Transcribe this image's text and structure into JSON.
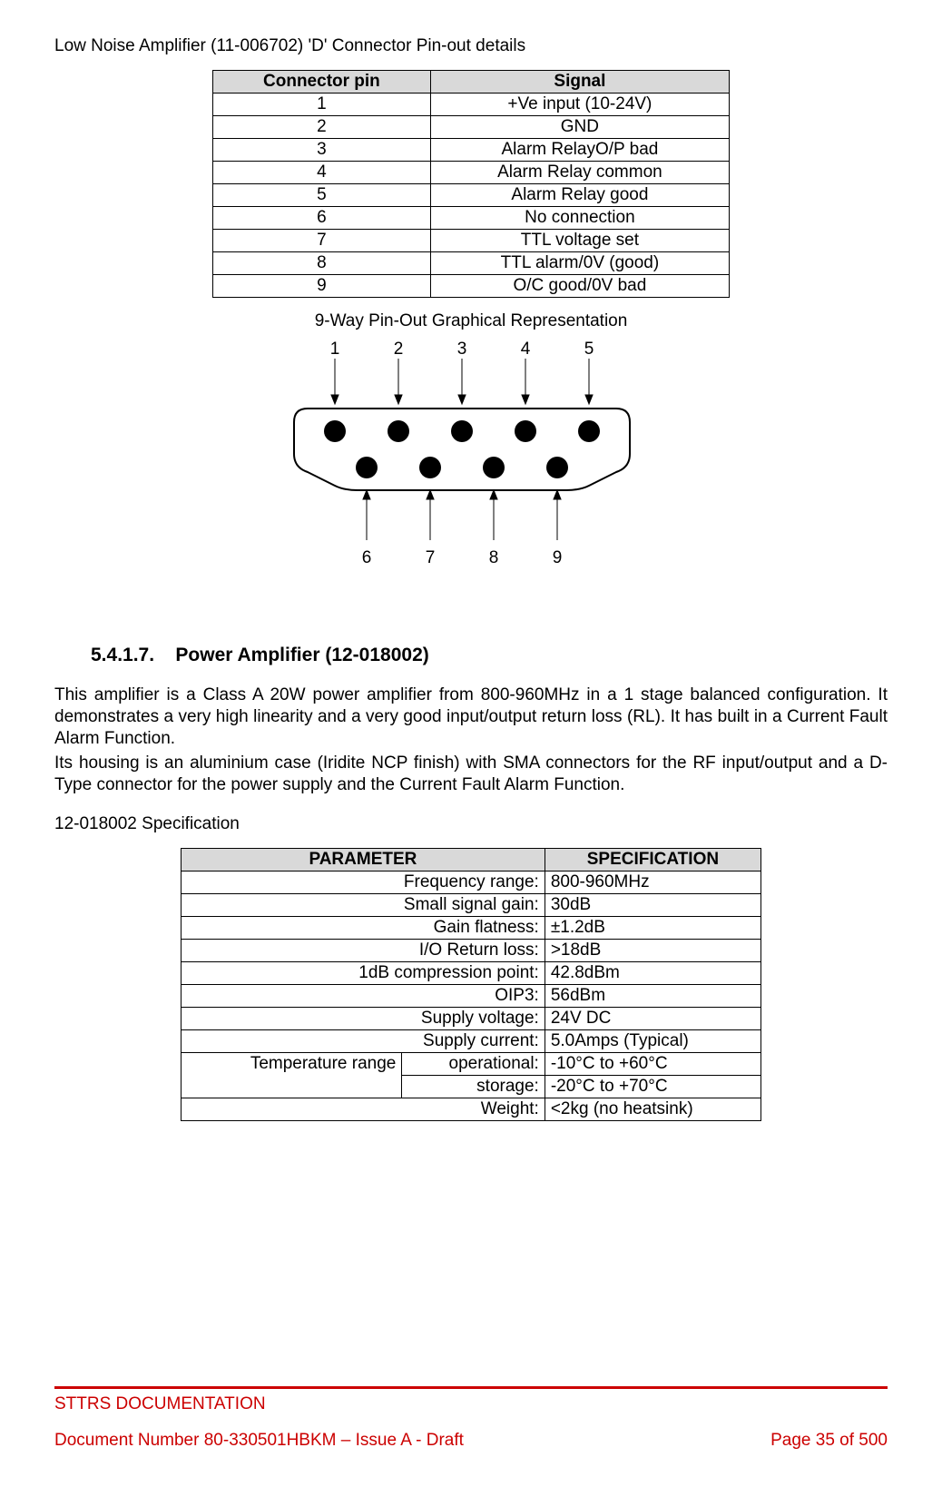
{
  "page_title": "Low Noise Amplifier (11-006702) 'D' Connector Pin-out details",
  "pinout_table": {
    "headers": [
      "Connector pin",
      "Signal"
    ],
    "rows": [
      {
        "pin": "1",
        "signal": "+Ve input (10-24V)"
      },
      {
        "pin": "2",
        "signal": "GND"
      },
      {
        "pin": "3",
        "signal": "Alarm RelayO/P bad"
      },
      {
        "pin": "4",
        "signal": "Alarm Relay common"
      },
      {
        "pin": "5",
        "signal": "Alarm Relay good"
      },
      {
        "pin": "6",
        "signal": "No connection"
      },
      {
        "pin": "7",
        "signal": "TTL voltage set"
      },
      {
        "pin": "8",
        "signal": "TTL alarm/0V (good)"
      },
      {
        "pin": "9",
        "signal": "O/C good/0V bad"
      }
    ]
  },
  "diagram_caption": "9-Way Pin-Out Graphical Representation",
  "pin_labels_top": [
    "1",
    "2",
    "3",
    "4",
    "5"
  ],
  "pin_labels_bottom": [
    "6",
    "7",
    "8",
    "9"
  ],
  "section": {
    "number": "5.4.1.7.",
    "title": "Power Amplifier (12-018002)"
  },
  "paragraph1": "This amplifier is a Class A 20W power amplifier from 800-960MHz in a 1 stage balanced configuration. It demonstrates a very high linearity and a very good input/output return loss (RL). It has built in a Current Fault Alarm Function.",
  "paragraph2": "Its housing is an aluminium case (Iridite NCP finish) with SMA connectors for the RF input/output and a D-Type connector for the power supply and the Current Fault Alarm Function.",
  "spec_label": "12-018002 Specification",
  "spec_table": {
    "headers": [
      "PARAMETER",
      "SPECIFICATION"
    ],
    "rows": [
      {
        "param": "Frequency range:",
        "val": "800-960MHz"
      },
      {
        "param": "Small signal gain:",
        "val": "30dB"
      },
      {
        "param": "Gain flatness:",
        "val": "±1.2dB"
      },
      {
        "param": "I/O Return loss:",
        "val": ">18dB"
      },
      {
        "param": "1dB compression point:",
        "val": "42.8dBm"
      },
      {
        "param": "OIP3:",
        "val": "56dBm"
      },
      {
        "param": "Supply voltage:",
        "val": "24V DC"
      },
      {
        "param": "Supply current:",
        "val": "5.0Amps (Typical)"
      }
    ],
    "temp_group_label": "Temperature range",
    "temp_rows": [
      {
        "param": "operational:",
        "val": "-10°C to +60°C"
      },
      {
        "param": "storage:",
        "val": "-20°C to +70°C"
      }
    ],
    "last_row": {
      "param": "Weight:",
      "val": "<2kg (no heatsink)"
    }
  },
  "footer": {
    "line1": "STTRS DOCUMENTATION",
    "doc": "Document Number 80-330501HBKM – Issue A - Draft",
    "page": "Page 35 of 500"
  }
}
